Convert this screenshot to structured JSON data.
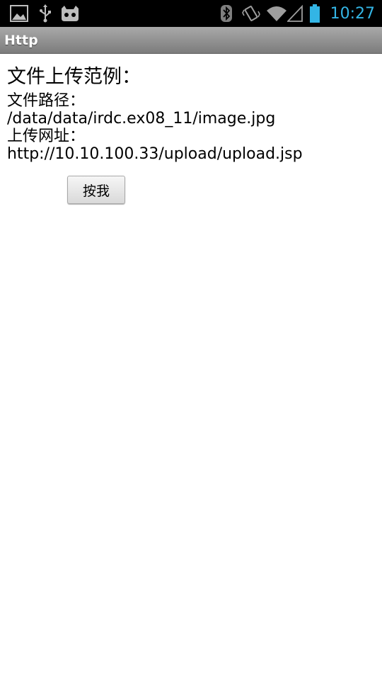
{
  "status_bar": {
    "time": "10:27",
    "icons": [
      "image-icon",
      "usb-icon",
      "cyanogen-mascot-icon",
      "bluetooth-icon",
      "vibrate-icon",
      "wifi-icon",
      "signal-icon",
      "battery-icon"
    ],
    "time_color": "#33b5e5"
  },
  "app": {
    "title": "Http"
  },
  "main": {
    "heading": "文件上传范例：",
    "path_label": "文件路径：",
    "path_value": "/data/data/irdc.ex08_11/image.jpg",
    "url_label": "上传网址：",
    "url_value": "http://10.10.100.33/upload/upload.jsp",
    "button_label": "按我"
  }
}
